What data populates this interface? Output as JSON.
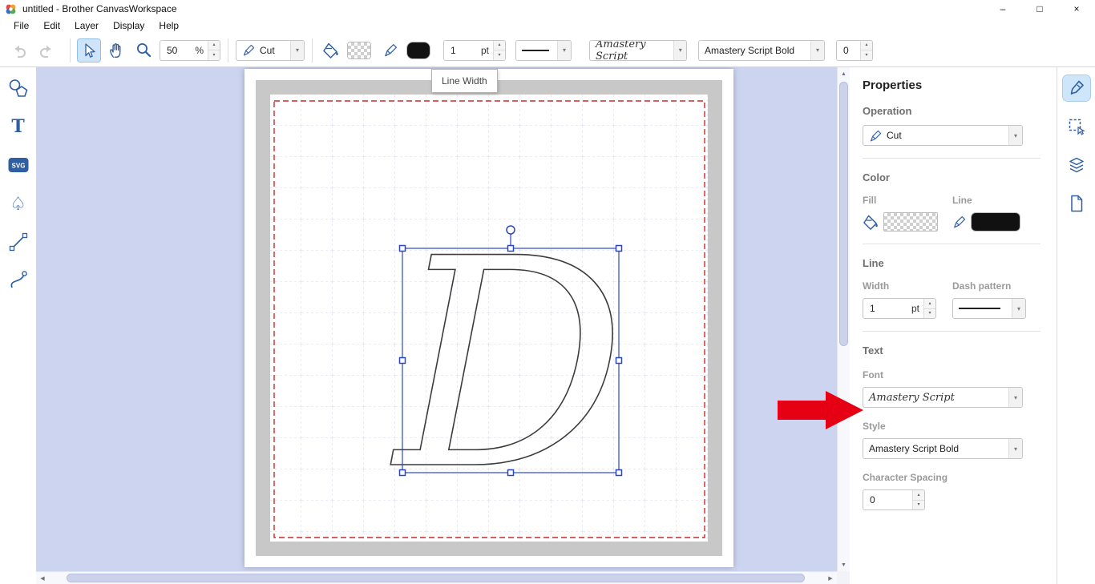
{
  "titlebar": {
    "title": "untitled - Brother CanvasWorkspace",
    "minimize": "–",
    "maximize": "□",
    "close": "×"
  },
  "menubar": {
    "items": [
      "File",
      "Edit",
      "Layer",
      "Display",
      "Help"
    ]
  },
  "toolbar": {
    "zoom_value": "50",
    "zoom_unit": "%",
    "operation_value": "Cut",
    "line_width_value": "1",
    "line_width_unit": "pt",
    "font_value": "Amastery Script",
    "style_value": "Amastery Script Bold",
    "char_spacing_value": "0"
  },
  "tooltip": {
    "text": "Line Width"
  },
  "canvas": {
    "selected_letter": "D"
  },
  "properties": {
    "title": "Properties",
    "operation": {
      "label": "Operation",
      "value": "Cut"
    },
    "color": {
      "label": "Color",
      "fill_label": "Fill",
      "line_label": "Line"
    },
    "line": {
      "label": "Line",
      "width_label": "Width",
      "width_value": "1",
      "width_unit": "pt",
      "dash_label": "Dash pattern"
    },
    "text": {
      "label": "Text",
      "font_label": "Font",
      "font_value": "Amastery Script",
      "style_label": "Style",
      "style_value": "Amastery Script Bold",
      "spacing_label": "Character Spacing",
      "spacing_value": "0"
    }
  },
  "icons": {
    "spin_up": "▴",
    "spin_down": "▾",
    "chevron_down": "▾",
    "scroll_up": "▲",
    "scroll_down": "▼",
    "scroll_left": "◀",
    "scroll_right": "▶",
    "text_tool": "T",
    "svg_label": "SVG",
    "spade": "♤"
  },
  "colors": {
    "accent_blue": "#2e5fa3",
    "selection_blue": "#2a46c8",
    "canvas_bg": "#ccd4ef",
    "seam_red": "#cc2a2a",
    "arrow_red": "#e60013",
    "line_color": "#111111"
  }
}
